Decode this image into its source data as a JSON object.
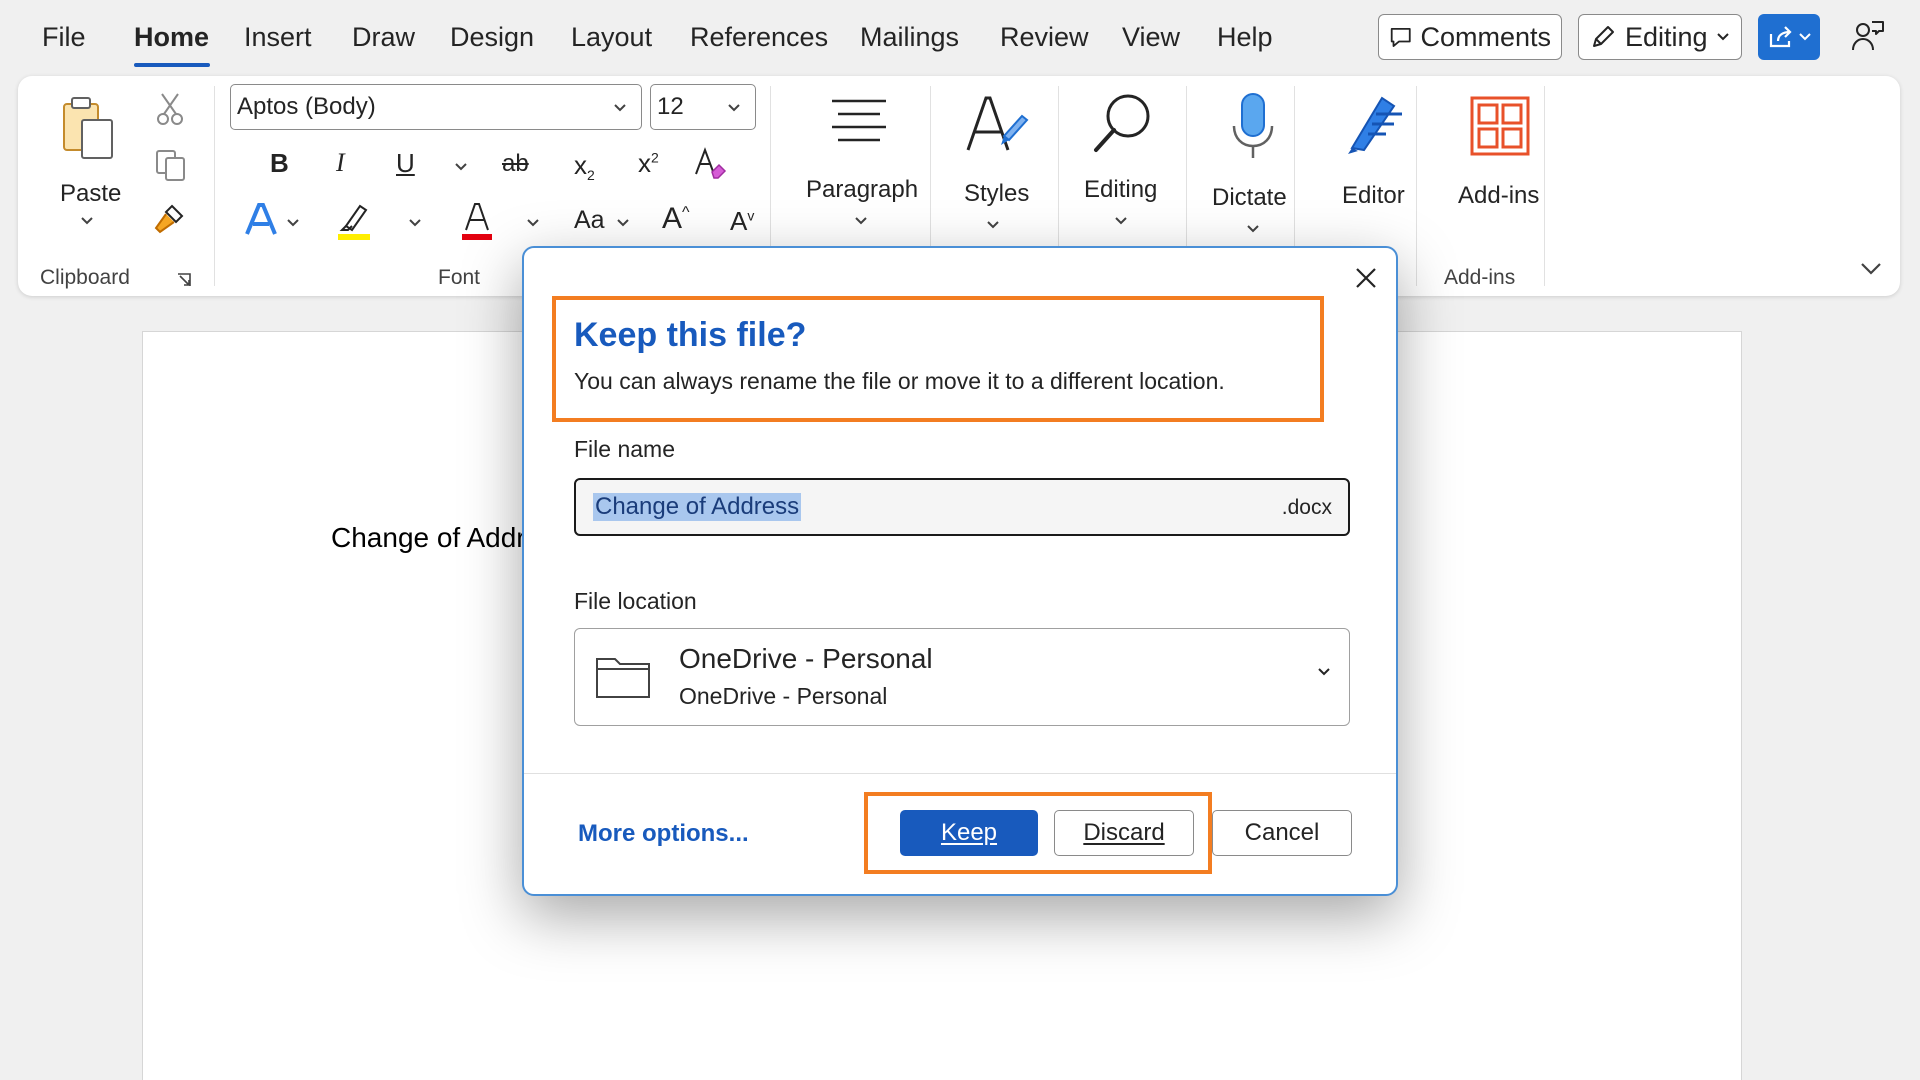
{
  "menu": {
    "items": [
      "File",
      "Home",
      "Insert",
      "Draw",
      "Design",
      "Layout",
      "References",
      "Mailings",
      "Review",
      "View",
      "Help"
    ],
    "active": "Home",
    "comments_label": "Comments",
    "editing_label": "Editing"
  },
  "ribbon": {
    "clipboard": {
      "paste_label": "Paste",
      "group_label": "Clipboard"
    },
    "font": {
      "font_name": "Aptos (Body)",
      "font_size": "12",
      "group_label": "Font",
      "bold": "B",
      "italic": "I",
      "underline": "U",
      "strike": "ab",
      "subscript": "x",
      "superscript": "x",
      "change_case": "Aa",
      "grow": "A",
      "shrink": "A"
    },
    "paragraph_label": "Paragraph",
    "styles_label": "Styles",
    "editing_label": "Editing",
    "dictate_label": "Dictate",
    "editor_label": "Editor",
    "addins_label": "Add-ins",
    "addins_group_label": "Add-ins"
  },
  "document": {
    "text": "Change of Address"
  },
  "dialog": {
    "title": "Keep this file?",
    "subtitle": "You can always rename the file or move it to a different location.",
    "file_name_label": "File name",
    "file_name_value": "Change of Address",
    "file_ext": ".docx",
    "file_location_label": "File location",
    "location_main": "OneDrive - Personal",
    "location_sub": "OneDrive - Personal",
    "more_options": "More options...",
    "keep": "Keep",
    "discard": "Discard",
    "cancel": "Cancel"
  },
  "colors": {
    "accent": "#185abd",
    "highlight_box": "#f37d21",
    "selection": "#a9c7ee"
  }
}
